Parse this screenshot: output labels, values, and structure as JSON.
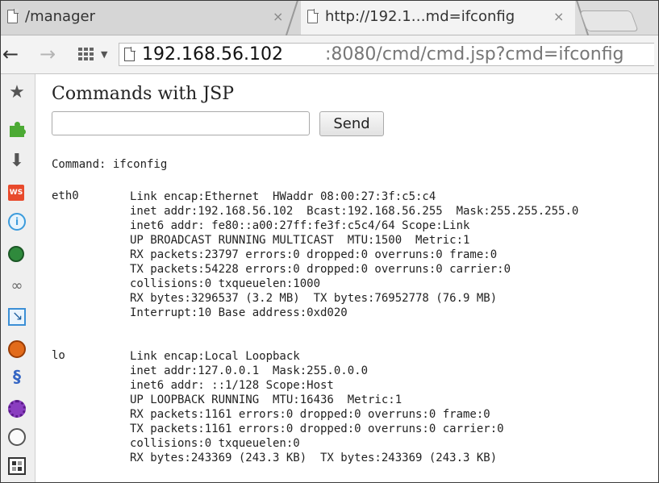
{
  "tabs": [
    {
      "title": "/manager",
      "close": "×",
      "active": false
    },
    {
      "title": "http://192.1…md=ifconfig",
      "close": "×",
      "active": true
    }
  ],
  "toolbar": {
    "back_icon": "←",
    "forward_icon": "→",
    "url_host": "192.168.56.102",
    "url_rest": ":8080/cmd/cmd.jsp?cmd=ifconfig"
  },
  "sidebar_icons": [
    "star-icon",
    "puzzle-icon",
    "download-icon",
    "ws-icon",
    "info-bubble-icon",
    "green-circle-icon",
    "links-icon",
    "cursor-icon",
    "orange-icon",
    "blue-s-icon",
    "purple-icon",
    "palette-icon",
    "grid-icon"
  ],
  "page": {
    "title": "Commands with JSP",
    "input_value": "",
    "send_label": "Send",
    "command_label": "Command: ifconfig"
  },
  "interfaces": [
    {
      "name": "eth0",
      "lines": [
        "Link encap:Ethernet  HWaddr 08:00:27:3f:c5:c4",
        "inet addr:192.168.56.102  Bcast:192.168.56.255  Mask:255.255.255.0",
        "inet6 addr: fe80::a00:27ff:fe3f:c5c4/64 Scope:Link",
        "UP BROADCAST RUNNING MULTICAST  MTU:1500  Metric:1",
        "RX packets:23797 errors:0 dropped:0 overruns:0 frame:0",
        "TX packets:54228 errors:0 dropped:0 overruns:0 carrier:0",
        "collisions:0 txqueuelen:1000",
        "RX bytes:3296537 (3.2 MB)  TX bytes:76952778 (76.9 MB)",
        "Interrupt:10 Base address:0xd020"
      ]
    },
    {
      "name": "lo",
      "lines": [
        "Link encap:Local Loopback",
        "inet addr:127.0.0.1  Mask:255.0.0.0",
        "inet6 addr: ::1/128 Scope:Host",
        "UP LOOPBACK RUNNING  MTU:16436  Metric:1",
        "RX packets:1161 errors:0 dropped:0 overruns:0 frame:0",
        "TX packets:1161 errors:0 dropped:0 overruns:0 carrier:0",
        "collisions:0 txqueuelen:0",
        "RX bytes:243369 (243.3 KB)  TX bytes:243369 (243.3 KB)"
      ]
    }
  ]
}
